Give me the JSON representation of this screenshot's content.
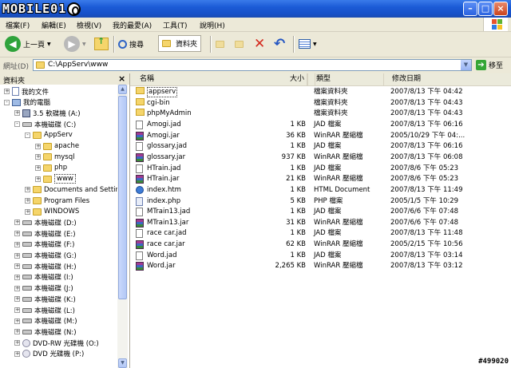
{
  "logo_text": "MOBILE01",
  "menubar": [
    "檔案(F)",
    "編輯(E)",
    "檢視(V)",
    "我的最愛(A)",
    "工具(T)",
    "說明(H)"
  ],
  "toolbar": {
    "back_label": "上一頁",
    "search_label": "搜尋",
    "folders_label": "資料夾"
  },
  "address": {
    "label": "網址(D)",
    "path": "C:\\AppServ\\www",
    "go_label": "移至"
  },
  "tree": {
    "title": "資料夾",
    "items": [
      {
        "label": "我的文件",
        "icon": "doc",
        "level": 0,
        "expander": "+"
      },
      {
        "label": "我的電腦",
        "icon": "pc",
        "level": 0,
        "expander": "-"
      },
      {
        "label": "3.5 軟碟機 (A:)",
        "icon": "floppy",
        "level": 1,
        "expander": "+"
      },
      {
        "label": "本機磁碟 (C:)",
        "icon": "drive",
        "level": 1,
        "expander": "-"
      },
      {
        "label": "AppServ",
        "icon": "folder",
        "level": 2,
        "expander": "-"
      },
      {
        "label": "apache",
        "icon": "folder",
        "level": 3,
        "expander": "+"
      },
      {
        "label": "mysql",
        "icon": "folder",
        "level": 3,
        "expander": "+"
      },
      {
        "label": "php",
        "icon": "folder",
        "level": 3,
        "expander": "+"
      },
      {
        "label": "www",
        "icon": "folder",
        "level": 3,
        "expander": "+",
        "selected": true
      },
      {
        "label": "Documents and Settin",
        "icon": "folder",
        "level": 2,
        "expander": "+"
      },
      {
        "label": "Program Files",
        "icon": "folder",
        "level": 2,
        "expander": "+"
      },
      {
        "label": "WINDOWS",
        "icon": "folder",
        "level": 2,
        "expander": "+"
      },
      {
        "label": "本機磁碟 (D:)",
        "icon": "drive",
        "level": 1,
        "expander": "+"
      },
      {
        "label": "本機磁碟 (E:)",
        "icon": "drive",
        "level": 1,
        "expander": "+"
      },
      {
        "label": "本機磁碟 (F:)",
        "icon": "drive",
        "level": 1,
        "expander": "+"
      },
      {
        "label": "本機磁碟 (G:)",
        "icon": "drive",
        "level": 1,
        "expander": "+"
      },
      {
        "label": "本機磁碟 (H:)",
        "icon": "drive",
        "level": 1,
        "expander": "+"
      },
      {
        "label": "本機磁碟 (I:)",
        "icon": "drive",
        "level": 1,
        "expander": "+"
      },
      {
        "label": "本機磁碟 (J:)",
        "icon": "drive",
        "level": 1,
        "expander": "+"
      },
      {
        "label": "本機磁碟 (K:)",
        "icon": "drive",
        "level": 1,
        "expander": "+"
      },
      {
        "label": "本機磁碟 (L:)",
        "icon": "drive",
        "level": 1,
        "expander": "+"
      },
      {
        "label": "本機磁碟 (M:)",
        "icon": "drive",
        "level": 1,
        "expander": "+"
      },
      {
        "label": "本機磁碟 (N:)",
        "icon": "drive",
        "level": 1,
        "expander": "+"
      },
      {
        "label": "DVD-RW 光碟機 (O:)",
        "icon": "cd",
        "level": 1,
        "expander": "+"
      },
      {
        "label": "DVD 光碟機 (P:)",
        "icon": "cd",
        "level": 1,
        "expander": "+"
      }
    ]
  },
  "columns": {
    "name": "名稱",
    "size": "大小",
    "type": "類型",
    "modified": "修改日期"
  },
  "files": [
    {
      "name": "appserv",
      "size": "",
      "type": "檔案資料夾",
      "modified": "2007/8/13 下午 04:42",
      "icon": "folder"
    },
    {
      "name": "cgi-bin",
      "size": "",
      "type": "檔案資料夾",
      "modified": "2007/8/13 下午 04:43",
      "icon": "folder"
    },
    {
      "name": "phpMyAdmin",
      "size": "",
      "type": "檔案資料夾",
      "modified": "2007/8/13 下午 04:43",
      "icon": "folder"
    },
    {
      "name": "Amogi.jad",
      "size": "1 KB",
      "type": "JAD 檔案",
      "modified": "2007/8/13 下午 06:16",
      "icon": "doc"
    },
    {
      "name": "Amogi.jar",
      "size": "36 KB",
      "type": "WinRAR 壓縮檔",
      "modified": "2005/10/29 下午 04:...",
      "icon": "rar"
    },
    {
      "name": "glossary.jad",
      "size": "1 KB",
      "type": "JAD 檔案",
      "modified": "2007/8/13 下午 06:16",
      "icon": "doc"
    },
    {
      "name": "glossary.jar",
      "size": "937 KB",
      "type": "WinRAR 壓縮檔",
      "modified": "2007/8/13 下午 06:08",
      "icon": "rar"
    },
    {
      "name": "HTrain.jad",
      "size": "1 KB",
      "type": "JAD 檔案",
      "modified": "2007/8/6 下午 05:23",
      "icon": "doc"
    },
    {
      "name": "HTrain.jar",
      "size": "21 KB",
      "type": "WinRAR 壓縮檔",
      "modified": "2007/8/6 下午 05:23",
      "icon": "rar"
    },
    {
      "name": "index.htm",
      "size": "1 KB",
      "type": "HTML Document",
      "modified": "2007/8/13 下午 11:49",
      "icon": "html"
    },
    {
      "name": "index.php",
      "size": "5 KB",
      "type": "PHP 檔案",
      "modified": "2005/1/5 下午 10:29",
      "icon": "php"
    },
    {
      "name": "MTrain13.jad",
      "size": "1 KB",
      "type": "JAD 檔案",
      "modified": "2007/6/6 下午 07:48",
      "icon": "doc"
    },
    {
      "name": "MTrain13.jar",
      "size": "31 KB",
      "type": "WinRAR 壓縮檔",
      "modified": "2007/6/6 下午 07:48",
      "icon": "rar"
    },
    {
      "name": "race car.jad",
      "size": "1 KB",
      "type": "JAD 檔案",
      "modified": "2007/8/13 下午 11:48",
      "icon": "doc"
    },
    {
      "name": "race car.jar",
      "size": "62 KB",
      "type": "WinRAR 壓縮檔",
      "modified": "2005/2/15 下午 10:56",
      "icon": "rar"
    },
    {
      "name": "Word.jad",
      "size": "1 KB",
      "type": "JAD 檔案",
      "modified": "2007/8/13 下午 03:14",
      "icon": "doc"
    },
    {
      "name": "Word.jar",
      "size": "2,265 KB",
      "type": "WinRAR 壓縮檔",
      "modified": "2007/8/13 下午 03:12",
      "icon": "rar"
    }
  ],
  "watermark": "#499020",
  "colors": {
    "titlebar": "#1c5bd6",
    "chrome": "#ece9d8",
    "selection_bg": "#ffffe1",
    "folder": "#f5d56b"
  }
}
